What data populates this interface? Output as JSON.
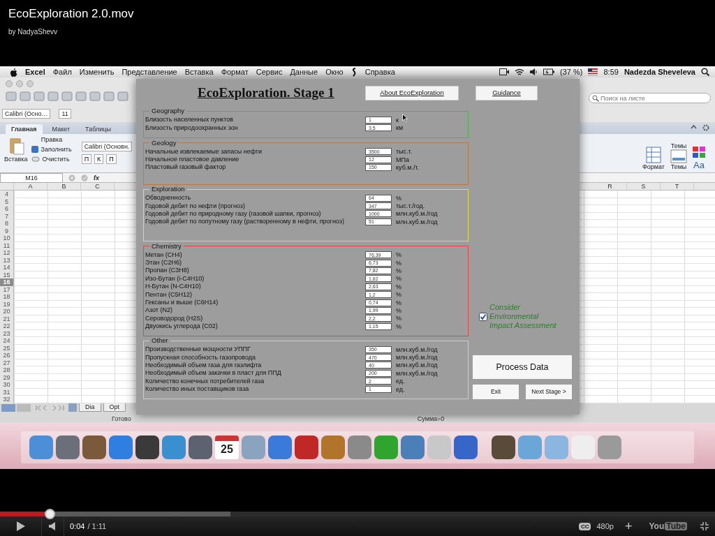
{
  "video": {
    "title": "EcoExploration 2.0.mov",
    "author": "by NadyaShevv"
  },
  "menubar": {
    "app": "Excel",
    "items": [
      "Файл",
      "Изменить",
      "Представление",
      "Вставка",
      "Формат",
      "Сервис",
      "Данные",
      "Окно"
    ],
    "help": "Справка",
    "battery": "(37 %)",
    "time": "8:59",
    "user": "Nadezda Sheveleva"
  },
  "excel": {
    "search_placeholder": "Поиск на листе",
    "font_name": "Calibri (Осно…",
    "font_size": "11",
    "ribbon_tabs": [
      {
        "label": "Главная",
        "selected": true
      },
      {
        "label": "Макет",
        "selected": false
      },
      {
        "label": "Таблицы",
        "selected": false
      }
    ],
    "group_label": "Правка",
    "paste": "Вставка",
    "fill": "Заполнить",
    "clear": "Очистить",
    "ribbon_font": "Calibri (Основн.",
    "style_buttons": [
      "П",
      "К",
      "П"
    ],
    "format": "Формат",
    "themes_label": "Темы",
    "themes": "Темы",
    "aa": "Aa",
    "cell_ref": "M16",
    "fx": "fx",
    "columns_left": [
      "A",
      "B",
      "C"
    ],
    "columns_right": [
      "R",
      "S",
      "T"
    ],
    "rows": [
      {
        "label": "4",
        "selected": false
      },
      {
        "label": "5",
        "selected": false
      },
      {
        "label": "6",
        "selected": false
      },
      {
        "label": "7",
        "selected": false
      },
      {
        "label": "8",
        "selected": false
      },
      {
        "label": "9",
        "selected": false
      },
      {
        "label": "10",
        "selected": false
      },
      {
        "label": "11",
        "selected": false
      },
      {
        "label": "12",
        "selected": false
      },
      {
        "label": "13",
        "selected": false
      },
      {
        "label": "14",
        "selected": false
      },
      {
        "label": "15",
        "selected": false
      },
      {
        "label": "16",
        "selected": true
      },
      {
        "label": "17",
        "selected": false
      },
      {
        "label": "18",
        "selected": false
      },
      {
        "label": "19",
        "selected": false
      },
      {
        "label": "20",
        "selected": false
      },
      {
        "label": "21",
        "selected": false
      },
      {
        "label": "22",
        "selected": false
      },
      {
        "label": "23",
        "selected": false
      },
      {
        "label": "24",
        "selected": false
      },
      {
        "label": "25",
        "selected": false
      },
      {
        "label": "26",
        "selected": false
      },
      {
        "label": "27",
        "selected": false
      },
      {
        "label": "28",
        "selected": false
      },
      {
        "label": "29",
        "selected": false
      },
      {
        "label": "30",
        "selected": false
      },
      {
        "label": "31",
        "selected": false
      },
      {
        "label": "32",
        "selected": false
      }
    ],
    "sheet_tabs": [
      "Dia",
      "Opt"
    ],
    "status": "Готово",
    "sum": "Сумма=0"
  },
  "form": {
    "title": "EcoExploration. Stage 1",
    "top_buttons": [
      "About EcoExploration",
      "Guidance"
    ],
    "sections": [
      {
        "title": "Geography",
        "color": "#4caf50",
        "fields": [
          {
            "label": "Близость населенных пунктов",
            "value": "1",
            "unit": "к"
          },
          {
            "label": "Близость природоохранных зон",
            "value": "3,5",
            "unit": "км"
          }
        ]
      },
      {
        "title": "Geology",
        "color": "#b5794a",
        "fields": [
          {
            "label": "Начальные извлекаемые запасы нефти",
            "value": "3500",
            "unit": "тыс.т."
          },
          {
            "label": "Начальное пластовое давление",
            "value": "12",
            "unit": "МПа"
          },
          {
            "label": "Пластовый газовый фактор",
            "value": "150",
            "unit": "куб.м./т."
          }
        ]
      },
      {
        "title": "Exploration",
        "color": "#e0e04a",
        "fields": [
          {
            "label": "Обводненность",
            "value": "64",
            "unit": "%"
          },
          {
            "label": "Годовой дебит по нефти (прогноз)",
            "value": "347",
            "unit": "тыс.т./год."
          },
          {
            "label": "Годовой дебит по природному газу (газовой шапки, прогноз)",
            "value": "1000",
            "unit": "млн.куб.м./год"
          },
          {
            "label": "Годовой дебит по попутному газу (растворенному в нефти, прогноз)",
            "value": "51",
            "unit": "млн.куб.м./год"
          }
        ]
      },
      {
        "title": "Chemistry",
        "color": "#e04848",
        "fields": [
          {
            "label": "Метан (CH4)",
            "value": "76,39",
            "unit": "%"
          },
          {
            "label": "Этан (C2H6)",
            "value": "6,73",
            "unit": "%"
          },
          {
            "label": "Пропан (C3H8)",
            "value": "7,82",
            "unit": "%"
          },
          {
            "label": "Изо-Бутан (i-C4H10)",
            "value": "1,62",
            "unit": "%"
          },
          {
            "label": "Н-Бутан (N-C4H10)",
            "value": "2,63",
            "unit": "%"
          },
          {
            "label": "Пентан (C5H12)",
            "value": "1,2",
            "unit": "%"
          },
          {
            "label": "Гексаны и выше (C6H14)",
            "value": "0,74",
            "unit": "%"
          },
          {
            "label": "Азот (N2)",
            "value": "1,99",
            "unit": "%"
          },
          {
            "label": "Сероводород (H2S)",
            "value": "2,2",
            "unit": "%"
          },
          {
            "label": "Двуокись углерода (C02)",
            "value": "1,15",
            "unit": "%"
          }
        ]
      },
      {
        "title": "Other",
        "color": "#cccccc",
        "fields": [
          {
            "label": "Производственные мощности УППГ",
            "value": "350",
            "unit": "млн.куб.м./год"
          },
          {
            "label": "Пропускная способность газопровода",
            "value": "470",
            "unit": "млн.куб.м./год"
          },
          {
            "label": "Необходимый объем газа для газлифта",
            "value": "40",
            "unit": "млн.куб.м./год"
          },
          {
            "label": "Необходимый объем закачки в пласт для ППД",
            "value": "200",
            "unit": "млн.куб.м./год"
          },
          {
            "label": "Количество конечных потребителей газа",
            "value": "2",
            "unit": "ед."
          },
          {
            "label": "Количество иных поставщиков газа",
            "value": "1",
            "unit": "ед."
          }
        ]
      }
    ],
    "consider": {
      "label": "Consider Environmental Impact Assessment",
      "checked": true
    },
    "process": "Process Data",
    "exit": "Exit",
    "next": "Next Stage >"
  },
  "dock": {
    "calendar_day": "25"
  },
  "player": {
    "progress": {
      "level": 0.069
    },
    "buffer": {
      "level": 0.322
    },
    "current": "0:04",
    "duration": "/ 1:11",
    "cc": "CC",
    "quality": "480p",
    "add": "+",
    "logo_left": "You",
    "logo_right": "Tube"
  }
}
